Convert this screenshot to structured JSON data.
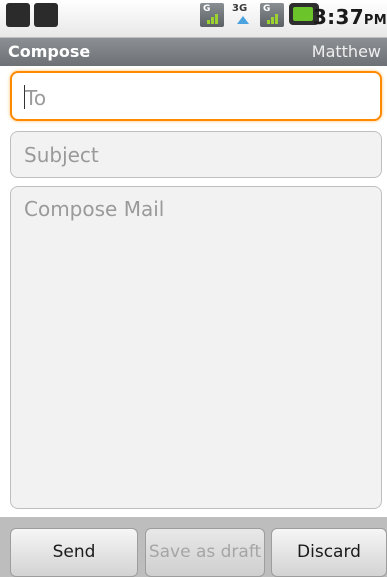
{
  "status_bar": {
    "time": "3:37",
    "ampm": "PM",
    "icons": [
      "usb-icon",
      "android-debug-icon",
      "signal-g-icon",
      "network-3g-icon",
      "signal-g-icon",
      "battery-icon"
    ],
    "network_label": "3G",
    "signal_label": "G",
    "accent": "#6bc42a"
  },
  "title_bar": {
    "title": "Compose",
    "account": "Matthew"
  },
  "fields": {
    "to_placeholder": "To",
    "subject_placeholder": "Subject",
    "body_placeholder": "Compose Mail",
    "focus_color": "#ff8a00"
  },
  "buttons": {
    "send": "Send",
    "save_draft": "Save as draft",
    "discard": "Discard"
  }
}
